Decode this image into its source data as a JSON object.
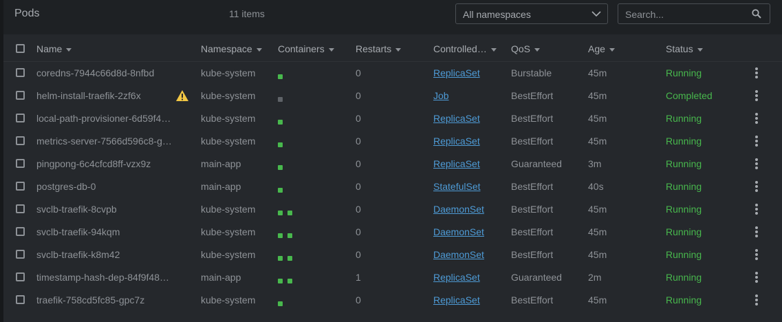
{
  "header": {
    "title": "Pods",
    "count": "11 items",
    "namespace_select": "All namespaces",
    "search_placeholder": "Search..."
  },
  "columns": [
    "Name",
    "Namespace",
    "Containers",
    "Restarts",
    "Controlled…",
    "QoS",
    "Age",
    "Status"
  ],
  "colors": {
    "running": "#48b84d",
    "completed": "#48b84d",
    "container_ready": "#48b84d",
    "container_terminated": "#5f6368",
    "link": "#4e9bd6",
    "warning": "#f2c744"
  },
  "rows": [
    {
      "name": "coredns-7944c66d8d-8nfbd",
      "namespace": "kube-system",
      "containers": [
        "ready"
      ],
      "restarts": "0",
      "controlled_by": "ReplicaSet",
      "qos": "Burstable",
      "age": "45m",
      "status": "Running",
      "warning": false
    },
    {
      "name": "helm-install-traefik-2zf6x",
      "namespace": "kube-system",
      "containers": [
        "terminated"
      ],
      "restarts": "0",
      "controlled_by": "Job",
      "qos": "BestEffort",
      "age": "45m",
      "status": "Completed",
      "warning": true
    },
    {
      "name": "local-path-provisioner-6d59f4…",
      "namespace": "kube-system",
      "containers": [
        "ready"
      ],
      "restarts": "0",
      "controlled_by": "ReplicaSet",
      "qos": "BestEffort",
      "age": "45m",
      "status": "Running",
      "warning": false
    },
    {
      "name": "metrics-server-7566d596c8-g…",
      "namespace": "kube-system",
      "containers": [
        "ready"
      ],
      "restarts": "0",
      "controlled_by": "ReplicaSet",
      "qos": "BestEffort",
      "age": "45m",
      "status": "Running",
      "warning": false
    },
    {
      "name": "pingpong-6c4cfcd8ff-vzx9z",
      "namespace": "main-app",
      "containers": [
        "ready"
      ],
      "restarts": "0",
      "controlled_by": "ReplicaSet",
      "qos": "Guaranteed",
      "age": "3m",
      "status": "Running",
      "warning": false
    },
    {
      "name": "postgres-db-0",
      "namespace": "main-app",
      "containers": [
        "ready"
      ],
      "restarts": "0",
      "controlled_by": "StatefulSet",
      "qos": "BestEffort",
      "age": "40s",
      "status": "Running",
      "warning": false
    },
    {
      "name": "svclb-traefik-8cvpb",
      "namespace": "kube-system",
      "containers": [
        "ready",
        "ready"
      ],
      "restarts": "0",
      "controlled_by": "DaemonSet",
      "qos": "BestEffort",
      "age": "45m",
      "status": "Running",
      "warning": false
    },
    {
      "name": "svclb-traefik-94kqm",
      "namespace": "kube-system",
      "containers": [
        "ready",
        "ready"
      ],
      "restarts": "0",
      "controlled_by": "DaemonSet",
      "qos": "BestEffort",
      "age": "45m",
      "status": "Running",
      "warning": false
    },
    {
      "name": "svclb-traefik-k8m42",
      "namespace": "kube-system",
      "containers": [
        "ready",
        "ready"
      ],
      "restarts": "0",
      "controlled_by": "DaemonSet",
      "qos": "BestEffort",
      "age": "45m",
      "status": "Running",
      "warning": false
    },
    {
      "name": "timestamp-hash-dep-84f9f48…",
      "namespace": "main-app",
      "containers": [
        "ready",
        "ready"
      ],
      "restarts": "1",
      "controlled_by": "ReplicaSet",
      "qos": "Guaranteed",
      "age": "2m",
      "status": "Running",
      "warning": false
    },
    {
      "name": "traefik-758cd5fc85-gpc7z",
      "namespace": "kube-system",
      "containers": [
        "ready"
      ],
      "restarts": "0",
      "controlled_by": "ReplicaSet",
      "qos": "BestEffort",
      "age": "45m",
      "status": "Running",
      "warning": false
    }
  ]
}
